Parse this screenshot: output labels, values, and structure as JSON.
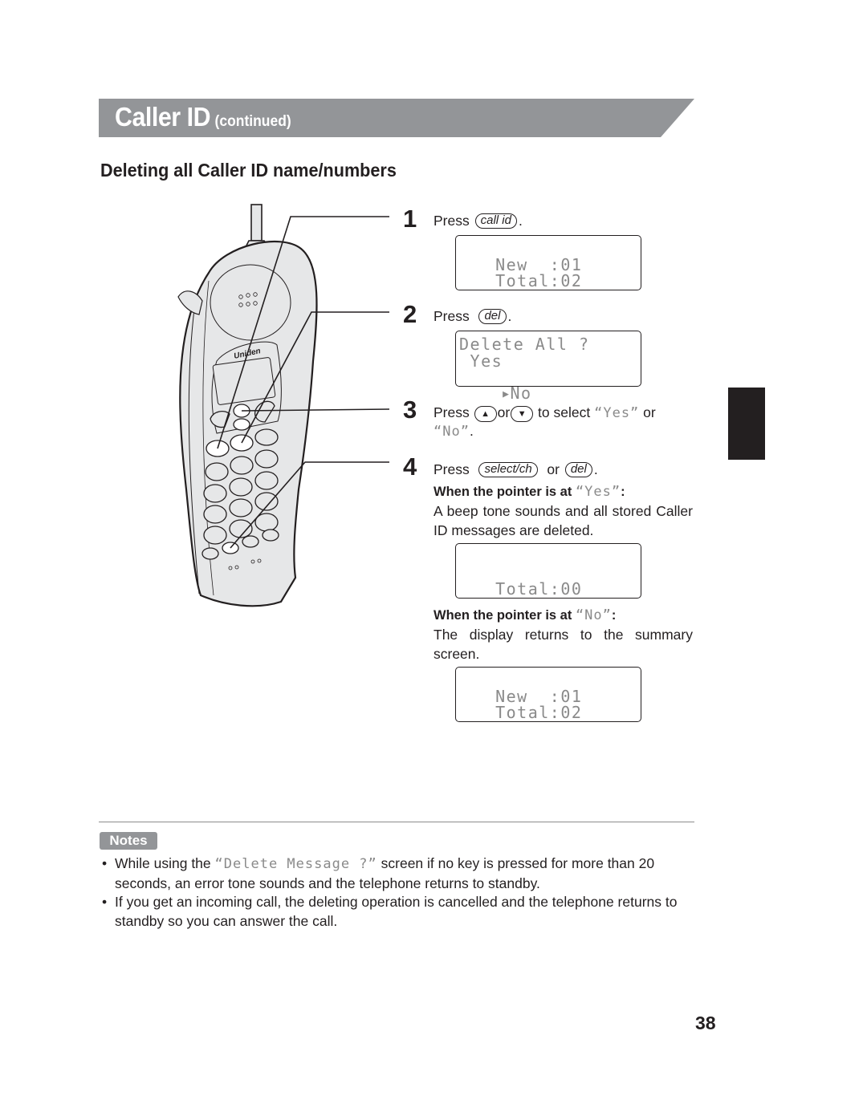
{
  "header": {
    "title": "Caller ID",
    "continued": "(continued)",
    "bar_color": "#939598"
  },
  "section": {
    "title": "Deleting all Caller ID name/numbers"
  },
  "phone": {
    "brand": "Uniden"
  },
  "steps": [
    {
      "number": "1",
      "press_label": "Press",
      "key": "call id",
      "after": ".",
      "display": [
        "  New  :01",
        "  Total:02"
      ]
    },
    {
      "number": "2",
      "press_label": "Press",
      "key": "del",
      "after": ".",
      "display": [
        "Delete All ?",
        " Yes",
        "No"
      ],
      "pointer_icon": "triangle-right"
    },
    {
      "number": "3",
      "press_label": "Press",
      "up_key": "▲",
      "or": "or",
      "down_key": "▼",
      "to_select": "to select",
      "opt_yes": "“Yes”",
      "or2": "or",
      "opt_no": "“No”",
      "after": "."
    },
    {
      "number": "4",
      "press_label": "Press",
      "key1": "select/ch",
      "or": "or",
      "key2": "del",
      "after": "."
    }
  ],
  "outcomes": {
    "yes": {
      "heading_prefix": "When the pointer is at",
      "heading_value": "“Yes”",
      "colon": ":",
      "text": "A beep tone sounds and all stored Caller ID messages are deleted.",
      "display": [
        "",
        "  Total:00"
      ]
    },
    "no": {
      "heading_prefix": "When the pointer is at",
      "heading_value": "“No”",
      "colon": ":",
      "text": "The display returns to the summary screen.",
      "display": [
        "  New  :01",
        "  Total:02"
      ]
    }
  },
  "notes": {
    "badge": "Notes",
    "items": [
      {
        "before": "While using the",
        "lcd": "“Delete Message ?”",
        "after": "screen if no key is pressed for more than 20 seconds, an error tone sounds and the telephone returns to standby."
      },
      {
        "before": "If you get an incoming call, the deleting operation is cancelled and the telephone returns to standby so you can answer the call.",
        "lcd": "",
        "after": ""
      }
    ]
  },
  "page_number": "38"
}
